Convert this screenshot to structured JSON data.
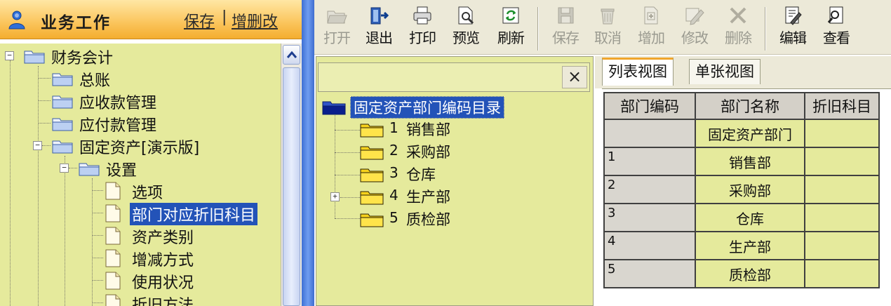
{
  "left_panel": {
    "header": {
      "title": "业务工作",
      "save_link": "保存",
      "separator": "|",
      "edit_link": "增删改",
      "user_icon": "user-icon"
    },
    "tree": {
      "root": "财务会计",
      "items": [
        "总账",
        "应收款管理",
        "应付款管理",
        "固定资产[演示版]",
        "设置",
        "选项",
        "部门对应折旧科目",
        "资产类别",
        "增减方式",
        "使用状况",
        "折旧方法"
      ],
      "selected": "部门对应折旧科目"
    }
  },
  "toolbar": {
    "buttons": [
      {
        "label": "打开",
        "icon": "open-folder-icon",
        "enabled": false
      },
      {
        "label": "退出",
        "icon": "exit-door-icon",
        "enabled": true
      },
      {
        "label": "打印",
        "icon": "printer-icon",
        "enabled": true
      },
      {
        "label": "预览",
        "icon": "preview-icon",
        "enabled": true
      },
      {
        "label": "刷新",
        "icon": "refresh-icon",
        "enabled": true
      },
      {
        "label": "保存",
        "icon": "save-disk-icon",
        "enabled": false
      },
      {
        "label": "取消",
        "icon": "cancel-trash-icon",
        "enabled": false
      },
      {
        "label": "增加",
        "icon": "add-doc-icon",
        "enabled": false
      },
      {
        "label": "修改",
        "icon": "edit-pencil-icon",
        "enabled": false
      },
      {
        "label": "删除",
        "icon": "delete-x-icon",
        "enabled": false
      },
      {
        "label": "编辑",
        "icon": "edit-doc-icon",
        "enabled": true
      },
      {
        "label": "查看",
        "icon": "view-search-icon",
        "enabled": true
      }
    ]
  },
  "middle_tree": {
    "close_label": "×",
    "root": "固定资产部门编码目录",
    "items": [
      {
        "num": "1",
        "name": "销售部",
        "expandable": false
      },
      {
        "num": "2",
        "name": "采购部",
        "expandable": false
      },
      {
        "num": "3",
        "name": "仓库",
        "expandable": false
      },
      {
        "num": "4",
        "name": "生产部",
        "expandable": true
      },
      {
        "num": "5",
        "name": "质检部",
        "expandable": false
      }
    ]
  },
  "right_panel": {
    "tabs": [
      "列表视图",
      "单张视图"
    ],
    "active_tab": "列表视图",
    "table": {
      "columns": [
        "部门编码",
        "部门名称",
        "折旧科目"
      ],
      "rows": [
        {
          "code": "",
          "name": "固定资产部门",
          "account": ""
        },
        {
          "code": "1",
          "name": "销售部",
          "account": ""
        },
        {
          "code": "2",
          "name": "采购部",
          "account": ""
        },
        {
          "code": "3",
          "name": "仓库",
          "account": ""
        },
        {
          "code": "4",
          "name": "生产部",
          "account": ""
        },
        {
          "code": "5",
          "name": "质检部",
          "account": ""
        }
      ]
    }
  },
  "colors": {
    "header_gradient": "#f4ad2f",
    "tree_background": "#e5ea9c",
    "selection": "#2353b8",
    "divider": "#4f80e0",
    "toolbar": "#ece9d8"
  }
}
